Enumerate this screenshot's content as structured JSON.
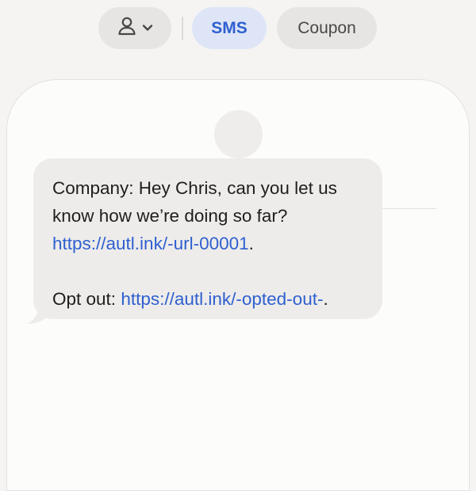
{
  "toolbar": {
    "contact_icon": "person-icon",
    "dropdown_icon": "chevron-down-icon",
    "sms_label": "SMS",
    "coupon_label": "Coupon"
  },
  "colors": {
    "accent": "#2f5fd0",
    "active_pill_bg": "#dee5f6",
    "pill_bg": "#e7e5e3",
    "bubble_bg": "#edecea",
    "page_bg": "#f5f4f3"
  },
  "message": {
    "text_1": "Company: Hey Chris, can you let us know how we’re doing so far? ",
    "link_1": "https://autl.ink/-url-00001",
    "text_2": ".\n\nOpt out: ",
    "link_2": "https://autl.ink/-opted-out-",
    "text_3": "."
  }
}
